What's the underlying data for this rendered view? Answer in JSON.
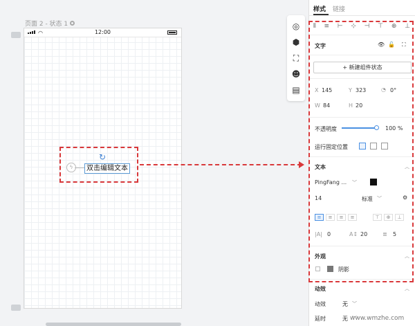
{
  "canvas": {
    "page_label": "页面 2 - 状态 1",
    "status_time": "12:00",
    "element_text": "双击编辑文本"
  },
  "toolbar_icons": [
    "target-icon",
    "cube-icon",
    "crop-icon",
    "emoji-icon",
    "layout-icon"
  ],
  "panel": {
    "tabs": [
      "样式",
      "链接"
    ],
    "section_text": "文字",
    "new_state_button": "+ 新建组件状态",
    "x_label": "X",
    "x_value": "145",
    "y_label": "Y",
    "y_value": "323",
    "rotation_value": "0°",
    "w_label": "W",
    "w_value": "84",
    "h_label": "H",
    "h_value": "20",
    "opacity_label": "不透明度",
    "opacity_value": "100 %",
    "opacity": 1.0,
    "fixed_position_label": "运行固定位置",
    "text_section": "文本",
    "font_family": "PingFang ...",
    "font_size": "14",
    "font_weight": "标准",
    "letter_spacing": "0",
    "line_height": "20",
    "paragraph_spacing": "5",
    "appearance_section": "外观",
    "shadow_label": "阴影",
    "animation_section": "动效",
    "animation_label": "动效",
    "animation_value": "无",
    "delay_label": "延时",
    "delay_value": "无"
  },
  "colors": {
    "accent": "#4a90e2",
    "highlight": "#d9383a",
    "text_color": "#000000"
  },
  "watermark": "www.wmzhe.com"
}
